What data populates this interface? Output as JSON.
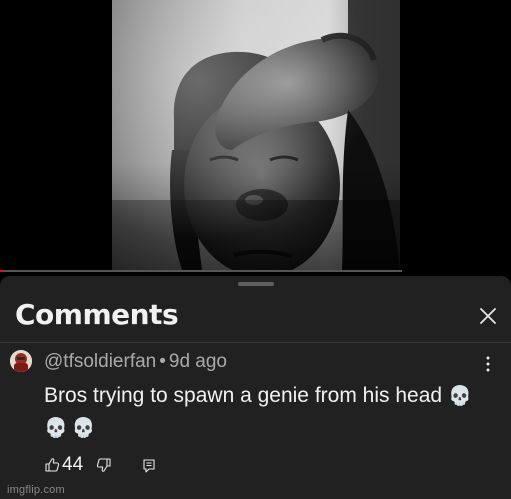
{
  "video": {
    "progress_fraction": 0.008,
    "colors": {
      "progress": "#ff0000",
      "track": "#555555"
    }
  },
  "comments_panel": {
    "title": "Comments",
    "close_icon": "close-icon"
  },
  "comment": {
    "author": "@tfsoldierfan",
    "separator": "•",
    "time_ago": "9d ago",
    "text": "Bros trying to spawn a genie from his head",
    "emojis": "💀💀💀",
    "like_count": "44",
    "icons": [
      "thumbs-up-icon",
      "thumbs-down-icon",
      "reply-icon",
      "more-vert-icon"
    ]
  },
  "watermark": "imgflip.com",
  "colors": {
    "sheet_background": "#212121",
    "text_primary": "#f1f1f1",
    "text_secondary": "#aaaaaa"
  }
}
